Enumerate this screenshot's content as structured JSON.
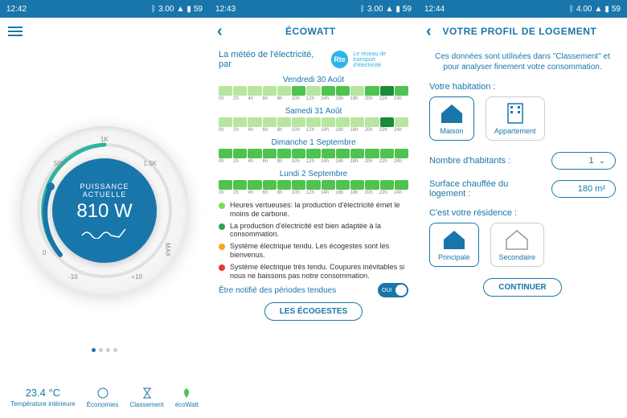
{
  "status": {
    "time1": "12:42",
    "time2": "12:43",
    "time3": "12:44",
    "net1": "3.00",
    "net2": "3.00",
    "net3": "4.00",
    "batt": "59"
  },
  "p1": {
    "dial_label1": "PUISSANCE",
    "dial_label2": "ACTUELLE",
    "dial_value": "810 W",
    "ticks": {
      "t0": "0",
      "t500": "500",
      "t1k": "1K",
      "t15": "1.5K",
      "tmax": "MAX",
      "n10": "-10",
      "p10": "+10"
    },
    "foot": {
      "temp_val": "23.4 °C",
      "temp_lbl": "Température intérieure",
      "eco": "Économies",
      "rank": "Classement",
      "ecowatt": "écoWatt"
    }
  },
  "p2": {
    "title": "ÉCOWATT",
    "intro": "La météo de l'électricité, par",
    "rte": "Rte",
    "rte_sub1": "Le réseau de transport",
    "rte_sub2": "d'électricité",
    "days": [
      {
        "name": "Vendredi 30 Août",
        "colors": [
          "lg",
          "lg",
          "lg",
          "lg",
          "lg",
          "g",
          "lg",
          "g",
          "g",
          "lg",
          "g",
          "dg",
          "g"
        ]
      },
      {
        "name": "Samedi 31 Août",
        "colors": [
          "lg",
          "lg",
          "lg",
          "lg",
          "lg",
          "lg",
          "lg",
          "lg",
          "lg",
          "lg",
          "lg",
          "dg",
          "lg"
        ]
      },
      {
        "name": "Dimanche 1 Septembre",
        "colors": [
          "g",
          "g",
          "g",
          "g",
          "g",
          "g",
          "g",
          "g",
          "g",
          "g",
          "g",
          "g",
          "g"
        ]
      },
      {
        "name": "Lundi 2 Septembre",
        "colors": [
          "g",
          "g",
          "g",
          "g",
          "g",
          "g",
          "g",
          "g",
          "g",
          "g",
          "g",
          "g",
          "g"
        ]
      }
    ],
    "hours": [
      "0h",
      "2h",
      "4h",
      "6h",
      "8h",
      "10h",
      "12h",
      "14h",
      "16h",
      "18h",
      "20h",
      "22h",
      "24h"
    ],
    "legend": [
      {
        "c": "#7ed957",
        "t": "Heures vertueuses: la production d'électricité émet le moins de carbone."
      },
      {
        "c": "#2ea44f",
        "t": "La production d'électricité est bien adaptée à la consommation."
      },
      {
        "c": "#f5a623",
        "t": "Système électrique tendu. Les écogestes sont les bienvenus."
      },
      {
        "c": "#e53935",
        "t": "Système électrique très tendu. Coupures inévitables si nous ne baissons pas notre consommation."
      }
    ],
    "notif_lbl": "Être notifié des périodes tendues",
    "notif_val": "OUI",
    "btn": "LES ÉCOGESTES",
    "colormap": {
      "lg": "#b8e6a0",
      "g": "#4fc24f",
      "dg": "#1b8a3a"
    }
  },
  "p3": {
    "title": "VOTRE PROFIL DE LOGEMENT",
    "intro": "Ces données sont utilisées dans \"Classement\" et pour analyser finement votre consommation.",
    "hab_lbl": "Votre habitation :",
    "hab_opts": [
      "Maison",
      "Appartement"
    ],
    "occ_lbl": "Nombre d'habitants :",
    "occ_val": "1",
    "surf_lbl": "Surface chauffée du logement :",
    "surf_val": "180  m²",
    "res_lbl": "C'est votre résidence :",
    "res_opts": [
      "Principale",
      "Secondaire"
    ],
    "btn": "CONTINUER"
  }
}
